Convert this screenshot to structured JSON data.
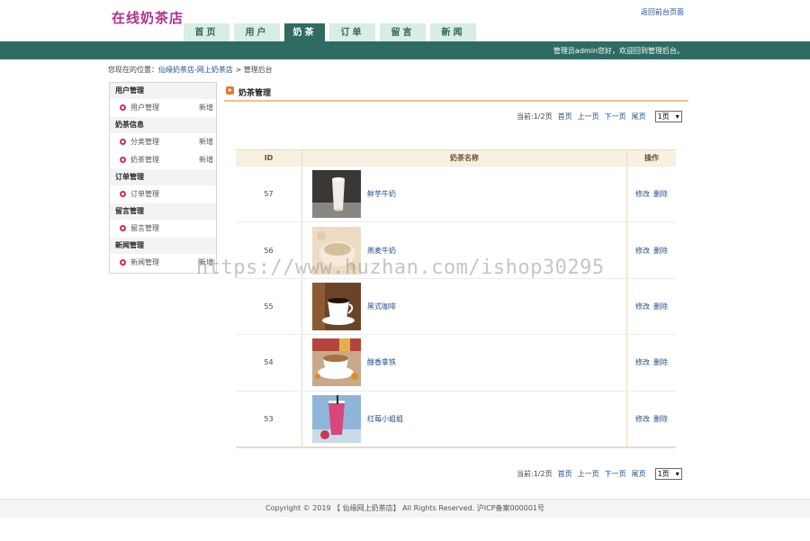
{
  "site": {
    "logo": "在线奶茶店",
    "top_link": "返回前台页面"
  },
  "nav": {
    "items": [
      "首页",
      "用户",
      "奶茶",
      "订单",
      "留言",
      "新闻"
    ],
    "active": "奶茶"
  },
  "header": {
    "welcome": "管理员admin您好，欢迎回到管理后台。"
  },
  "breadcrumb": {
    "prefix": "您现在的位置：",
    "site_link": "仙缘奶茶店-网上奶茶店",
    "sep": ">",
    "current": "管理后台"
  },
  "sidebar": {
    "groups": [
      {
        "title": "用户管理",
        "items": [
          {
            "label": "用户管理",
            "add": "新增"
          }
        ]
      },
      {
        "title": "奶茶信息",
        "items": [
          {
            "label": "分类管理",
            "add": "新增"
          },
          {
            "label": "奶茶管理",
            "add": "新增"
          }
        ]
      },
      {
        "title": "订单管理",
        "items": [
          {
            "label": "订单管理",
            "add": ""
          }
        ]
      },
      {
        "title": "留言管理",
        "items": [
          {
            "label": "留言管理",
            "add": ""
          }
        ]
      },
      {
        "title": "新闻管理",
        "items": [
          {
            "label": "新闻管理",
            "add": "新增"
          }
        ]
      }
    ]
  },
  "panel": {
    "title": "奶茶管理"
  },
  "pager": {
    "info": "当前:1/2页",
    "first": "首页",
    "prev": "上一页",
    "next": "下一页",
    "last": "尾页",
    "select": "1页"
  },
  "table": {
    "headers": {
      "id": "ID",
      "name": "奶茶名称",
      "op": "操作"
    },
    "rows": [
      {
        "id": "57",
        "name": "鲜芋牛奶",
        "edit": "修改",
        "del": "删除"
      },
      {
        "id": "56",
        "name": "燕麦牛奶",
        "edit": "修改",
        "del": "删除"
      },
      {
        "id": "55",
        "name": "黑式咖啡",
        "edit": "修改",
        "del": "删除"
      },
      {
        "id": "54",
        "name": "醇香拿铁",
        "edit": "修改",
        "del": "删除"
      },
      {
        "id": "53",
        "name": "红莓小姐姐",
        "edit": "修改",
        "del": "删除"
      }
    ]
  },
  "footer": {
    "text": "Copyright © 2019 【 仙缘网上奶茶店】 All Rights Reserved. 沪ICP备案000001号"
  },
  "watermark": "https://www.huzhan.com/ishop30295",
  "colors": {
    "brand": "#b1328f",
    "nav_active": "#2e6c63",
    "nav_bg": "#d8ede3",
    "link": "#1f4f8a",
    "bullet": "#d9265e",
    "title_icon": "#e8772a"
  }
}
